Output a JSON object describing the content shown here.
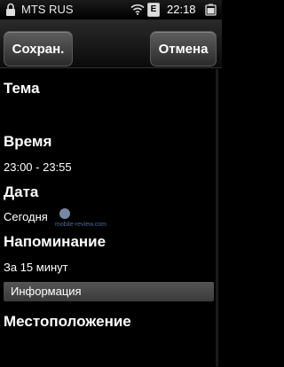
{
  "status_bar": {
    "carrier": "MTS RUS",
    "network_badge": "E",
    "time": "22:18",
    "icons": [
      "lock-icon",
      "wifi-icon",
      "battery-icon"
    ]
  },
  "toolbar": {
    "save_label": "Сохран.",
    "cancel_label": "Отмена"
  },
  "form": {
    "subject_label": "Тема",
    "time_label": "Время",
    "time_value": "23:00 - 23:55",
    "date_label": "Дата",
    "date_value": "Сегодня",
    "reminder_label": "Напоминание",
    "reminder_value": "За 15 минут",
    "info_label": "Информация",
    "location_label": "Местоположение"
  },
  "watermark": "mobile-review.com"
}
